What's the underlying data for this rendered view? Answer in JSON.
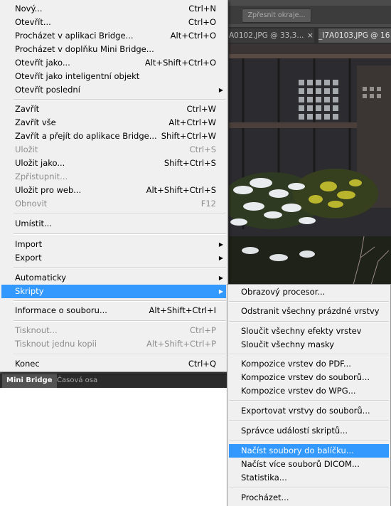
{
  "options_bar": {
    "refine_edge": "Zpřesnit okraje..."
  },
  "tabs": {
    "doc1": "A0102.JPG @ 33,3...",
    "doc1_close": "×",
    "doc2": "_I7A0103.JPG @ 16"
  },
  "panels": {
    "mini_bridge": "Mini Bridge",
    "timeline": "Časová osa"
  },
  "file_menu": {
    "new": {
      "label": "Nový...",
      "shortcut": "Ctrl+N"
    },
    "open": {
      "label": "Otevřít...",
      "shortcut": "Ctrl+O"
    },
    "browse_bridge": {
      "label": "Procházet v aplikaci Bridge...",
      "shortcut": "Alt+Ctrl+O"
    },
    "browse_mini_bridge": {
      "label": "Procházet v doplňku Mini Bridge..."
    },
    "open_as": {
      "label": "Otevřít jako...",
      "shortcut": "Alt+Shift+Ctrl+O"
    },
    "open_smart_object": {
      "label": "Otevřít jako inteligentní objekt"
    },
    "open_recent": {
      "label": "Otevřít poslední"
    },
    "close": {
      "label": "Zavřít",
      "shortcut": "Ctrl+W"
    },
    "close_all": {
      "label": "Zavřít vše",
      "shortcut": "Alt+Ctrl+W"
    },
    "close_go_bridge": {
      "label": "Zavřít a přejít do aplikace Bridge...",
      "shortcut": "Shift+Ctrl+W"
    },
    "save": {
      "label": "Uložit",
      "shortcut": "Ctrl+S"
    },
    "save_as": {
      "label": "Uložit jako...",
      "shortcut": "Shift+Ctrl+S"
    },
    "check_in": {
      "label": "Zpřístupnit..."
    },
    "save_for_web": {
      "label": "Uložit pro web...",
      "shortcut": "Alt+Shift+Ctrl+S"
    },
    "revert": {
      "label": "Obnovit",
      "shortcut": "F12"
    },
    "place": {
      "label": "Umístit..."
    },
    "import": {
      "label": "Import"
    },
    "export": {
      "label": "Export"
    },
    "automate": {
      "label": "Automaticky"
    },
    "scripts": {
      "label": "Skripty"
    },
    "file_info": {
      "label": "Informace o souboru...",
      "shortcut": "Alt+Shift+Ctrl+I"
    },
    "print": {
      "label": "Tisknout...",
      "shortcut": "Ctrl+P"
    },
    "print_one_copy": {
      "label": "Tisknout jednu kopii",
      "shortcut": "Alt+Shift+Ctrl+P"
    },
    "exit": {
      "label": "Konec",
      "shortcut": "Ctrl+Q"
    }
  },
  "scripts_menu": {
    "image_processor": "Obrazový procesor...",
    "delete_empty_layers": "Odstranit všechny prázdné vrstvy",
    "flatten_layer_effects": "Sloučit všechny efekty vrstev",
    "flatten_masks": "Sloučit všechny masky",
    "layer_comps_pdf": "Kompozice vrstev do PDF...",
    "layer_comps_files": "Kompozice vrstev do souborů...",
    "layer_comps_wpg": "Kompozice vrstev do WPG...",
    "export_layers": "Exportovat vrstvy do souborů...",
    "script_events_manager": "Správce událostí skriptů...",
    "load_files_into_stack": "Načíst soubory do balíčku...",
    "load_dicom": "Načíst více souborů DICOM...",
    "statistics": "Statistika...",
    "browse": "Procházet..."
  },
  "colors": {
    "highlight": "#3399ff",
    "menu_bg": "#f0f0f0",
    "app_bg": "#4b4b4b"
  },
  "icons": {
    "submenu": "chevron-right-icon"
  }
}
